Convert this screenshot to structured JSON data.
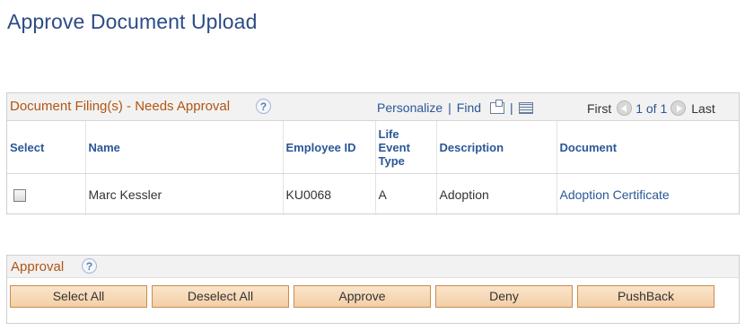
{
  "page": {
    "title": "Approve Document Upload"
  },
  "grid": {
    "title": "Document Filing(s) - Needs Approval",
    "tools": {
      "personalize": "Personalize",
      "find": "Find",
      "separator": "|"
    },
    "pager": {
      "first": "First",
      "count": "1 of 1",
      "last": "Last"
    },
    "columns": [
      "Select",
      "Name",
      "Employee ID",
      "Life Event Type",
      "Description",
      "Document"
    ],
    "rows": [
      {
        "name": "Marc Kessler",
        "employee_id": "KU0068",
        "life_event_type": "A",
        "description": "Adoption",
        "document": "Adoption Certificate",
        "selected": false
      }
    ]
  },
  "approval": {
    "title": "Approval",
    "buttons": {
      "select_all": "Select All",
      "deselect_all": "Deselect All",
      "approve": "Approve",
      "deny": "Deny",
      "pushback": "PushBack"
    }
  },
  "help_glyph": "?",
  "colors": {
    "title": "#2b4c86",
    "section_title": "#b25511",
    "link": "#2b5797",
    "button": "#f3cfa6"
  }
}
